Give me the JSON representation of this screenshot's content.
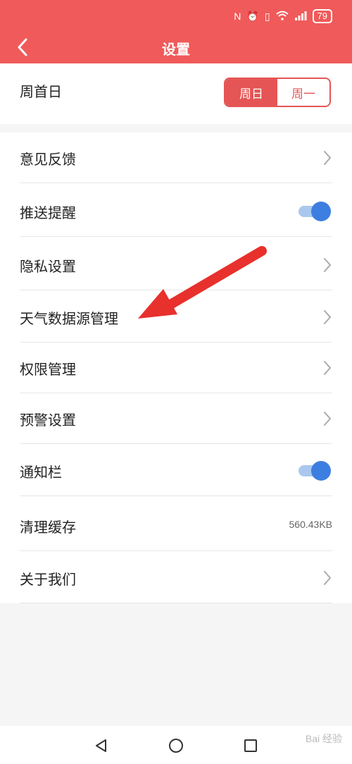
{
  "status_bar": {
    "battery": "79"
  },
  "header": {
    "title": "设置"
  },
  "week_start": {
    "label": "周首日",
    "options": [
      "周日",
      "周一"
    ],
    "selected": "周日"
  },
  "settings": {
    "feedback": "意见反馈",
    "push": "推送提醒",
    "privacy": "隐私设置",
    "weather_source": "天气数据源管理",
    "permissions": "权限管理",
    "warning": "预警设置",
    "notification_bar": "通知栏",
    "clear_cache": "清理缓存",
    "cache_size": "560.43KB",
    "about": "关于我们"
  },
  "toggles": {
    "push_enabled": true,
    "notification_bar_enabled": true
  },
  "colors": {
    "brand": "#f05a5a",
    "accent": "#e55555",
    "toggle_on": "#3d7fe0",
    "annotation_arrow": "#e8302c"
  },
  "watermark": "Bai 经验"
}
